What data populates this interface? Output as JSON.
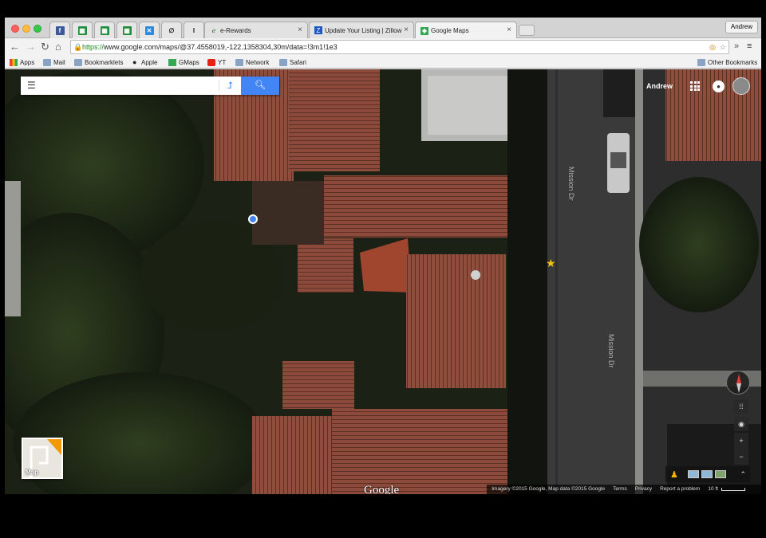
{
  "browser": {
    "tabs": [
      {
        "label": "e-Rewards",
        "icon": "e-icon"
      },
      {
        "label": "Update Your Listing | Zillow",
        "icon": "zillow-icon"
      },
      {
        "label": "Google Maps",
        "icon": "maps-icon"
      }
    ],
    "user": "Andrew",
    "url_scheme": "https://",
    "url_rest": "www.google.com/maps/@37.4558019,-122.1358304,30m/data=!3m1!1e3"
  },
  "bookmarks": [
    {
      "label": "Apps"
    },
    {
      "label": "Mail"
    },
    {
      "label": "Bookmarklets"
    },
    {
      "label": "Apple"
    },
    {
      "label": "GMaps"
    },
    {
      "label": "YT"
    },
    {
      "label": "Network"
    },
    {
      "label": "Safari"
    }
  ],
  "other_bookmarks": "Other Bookmarks",
  "map": {
    "account_name": "Andrew",
    "street_labels": [
      "Mission Dr",
      "Mission Dr"
    ],
    "minimap_label": "Map",
    "logo": "Google",
    "footer": {
      "imagery": "Imagery ©2015 Google, Map data ©2015 Google",
      "terms": "Terms",
      "privacy": "Privacy",
      "report": "Report a problem",
      "scale": "10 ft"
    }
  },
  "colors": {
    "map_blue": "#4285f4",
    "roof": "#8b4a3a",
    "road": "#3a3a3a"
  }
}
